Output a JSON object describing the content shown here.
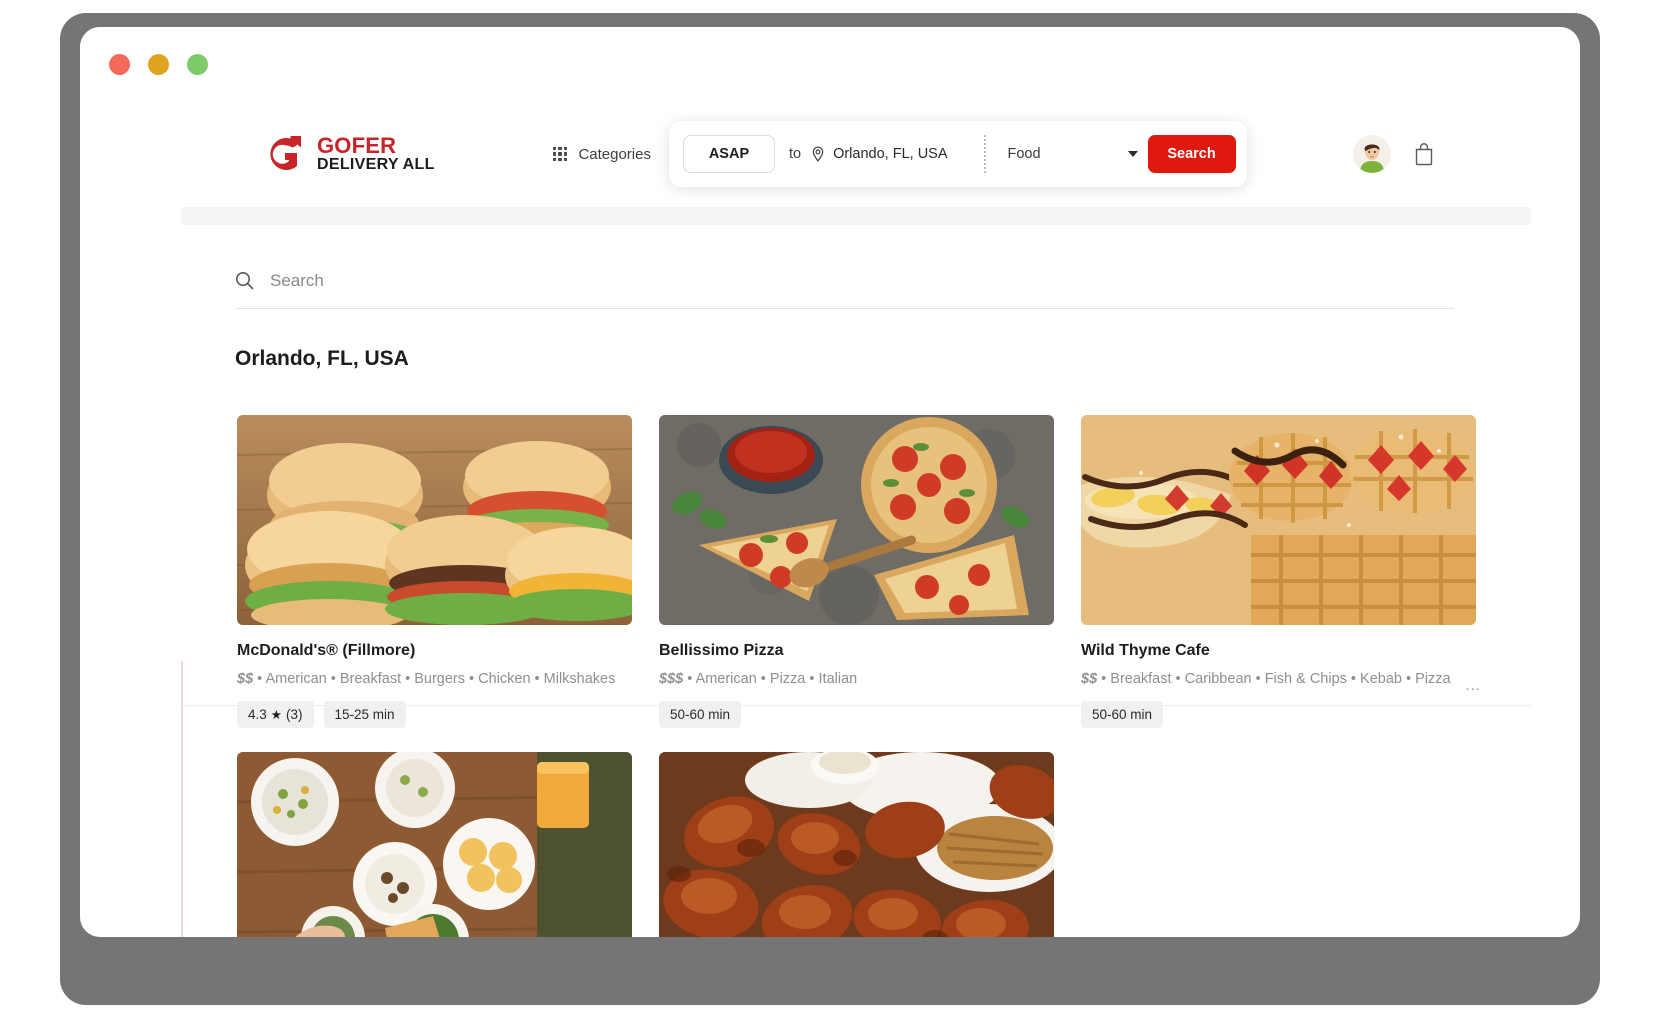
{
  "window": {
    "traffic_lights": [
      "close",
      "minimize",
      "maximize"
    ],
    "colors": {
      "close": "#f4695a",
      "minimize": "#dfa520",
      "maximize": "#7ecb69"
    }
  },
  "brand": {
    "name": "GOFER",
    "tagline": "DELIVERY ALL",
    "accent": "#c8252a",
    "logo_icon": "gofer-logo-icon"
  },
  "header": {
    "categories_label": "Categories",
    "categories_icon": "grid-icon",
    "search_bar": {
      "asap_label": "ASAP",
      "to_label": "to",
      "pin_icon": "location-pin-icon",
      "location_value": "Orlando, FL, USA",
      "category_value": "Food",
      "category_caret_icon": "chevron-down-icon",
      "search_label": "Search",
      "search_button_color": "#e0190f"
    },
    "avatar_icon": "user-avatar",
    "cart_icon": "shopping-bag-icon"
  },
  "main": {
    "search": {
      "icon": "search-icon",
      "placeholder": "Search",
      "value": ""
    },
    "city_heading": "Orlando, FL, USA",
    "overflow_indicator": "...",
    "cards": [
      {
        "name": "McDonald's® (Fillmore)",
        "price_level": "$$",
        "tags": "• American • Breakfast • Burgers • Chicken • Milkshakes",
        "rating": "4.3",
        "rating_star_icon": "star-icon",
        "rating_count": "(3)",
        "delivery_time": "15-25 min",
        "image_alt": "burgers-photo"
      },
      {
        "name": "Bellissimo Pizza",
        "price_level": "$$$",
        "tags": "• American • Pizza • Italian",
        "rating": "",
        "rating_star_icon": "star-icon",
        "rating_count": "",
        "delivery_time": "50-60 min",
        "image_alt": "pizza-photo"
      },
      {
        "name": "Wild Thyme Cafe",
        "price_level": "$$",
        "tags": "• Breakfast • Caribbean • Fish & Chips • Kebab • Pizza",
        "rating": "",
        "rating_star_icon": "star-icon",
        "rating_count": "",
        "delivery_time": "50-60 min",
        "image_alt": "waffles-photo"
      },
      {
        "name": "",
        "price_level": "",
        "tags": "",
        "rating": "",
        "rating_star_icon": "",
        "rating_count": "",
        "delivery_time": "",
        "image_alt": "indian-thali-photo"
      },
      {
        "name": "",
        "price_level": "",
        "tags": "",
        "rating": "",
        "rating_star_icon": "",
        "rating_count": "",
        "delivery_time": "",
        "image_alt": "bbq-chicken-photo"
      }
    ]
  }
}
